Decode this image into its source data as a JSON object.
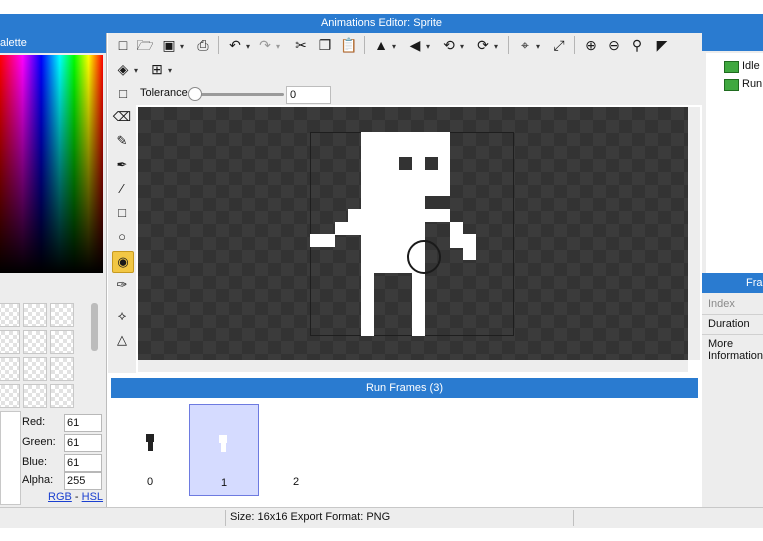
{
  "window": {
    "title": "Animations Editor: Sprite"
  },
  "palette": {
    "header": "alette",
    "rgba": [
      {
        "label": "Red:",
        "value": "61"
      },
      {
        "label": "Green:",
        "value": "61"
      },
      {
        "label": "Blue:",
        "value": "61"
      },
      {
        "label": "Alpha:",
        "value": "255"
      }
    ],
    "mode_rgb": "RGB",
    "mode_sep": " - ",
    "mode_hsl": "HSL"
  },
  "toolbar": {
    "tolerance_label": "Tolerance",
    "tolerance_value": "0",
    "icons": [
      "new-file-icon",
      "open-folder-icon",
      "save-icon",
      "export-icon",
      "undo-icon",
      "redo-icon",
      "cut-icon",
      "copy-icon",
      "paste-icon",
      "flip-horizontal-icon",
      "flip-vertical-icon",
      "rotate-left-icon",
      "rotate-right-icon",
      "crop-icon",
      "resize-icon",
      "zoom-in-icon",
      "zoom-out-icon",
      "zoom-fit-icon",
      "toggle-background-icon",
      "layers-icon",
      "grid-icon"
    ]
  },
  "tools": [
    "eraser-icon",
    "pencil-icon",
    "brush-icon",
    "line-icon",
    "rectangle-icon",
    "ellipse-icon",
    "fill-bucket-icon",
    "eyedropper-icon",
    "select-point-icon",
    "pivot-icon"
  ],
  "frames": {
    "header": "Run Frames (3)",
    "items": [
      {
        "index": "0"
      },
      {
        "index": "1"
      },
      {
        "index": "2"
      }
    ],
    "selected_index": 1
  },
  "animations": {
    "items": [
      {
        "label": "Idle"
      },
      {
        "label": "Run"
      }
    ]
  },
  "frame_panel": {
    "header": "Fra",
    "properties": [
      {
        "label": "Index"
      },
      {
        "label": "Duration"
      },
      {
        "label": "More Information"
      }
    ]
  },
  "status": {
    "text": "Size: 16x16   Export Format: PNG"
  },
  "colors": {
    "accent": "#2a7bd0",
    "selected_frame": "#d5dbff",
    "active_tool": "#f2c744",
    "sprite": "#ffffff",
    "canvas": "#333333"
  }
}
